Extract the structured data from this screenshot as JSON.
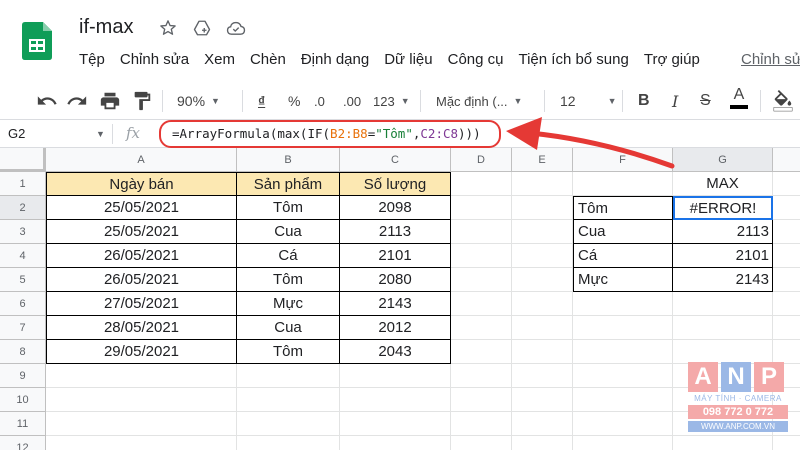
{
  "app": {
    "title": "if-max",
    "menu": [
      "Tệp",
      "Chỉnh sửa",
      "Xem",
      "Chèn",
      "Định dạng",
      "Dữ liệu",
      "Công cụ",
      "Tiện ích bổ sung",
      "Trợ giúp"
    ],
    "menu_last": "Chỉnh sử"
  },
  "toolbar": {
    "zoom": "90%",
    "currency": "₫",
    "percent": "%",
    "dec_decrease": ".0",
    "dec_increase": ".00",
    "format_more": "123",
    "font": "Mặc định (...",
    "font_size": "12",
    "bold": "B",
    "italic": "I",
    "strike": "S",
    "text_color": "A"
  },
  "formula_bar": {
    "name_box": "G2",
    "fx": "fx",
    "formula_parts": [
      "=ArrayFormula(max(IF(",
      "B2:B8",
      "=",
      "\"Tôm\"",
      ",",
      "C2:C8",
      ")))"
    ]
  },
  "grid": {
    "columns": [
      "A",
      "B",
      "C",
      "D",
      "E",
      "F",
      "G"
    ],
    "rows": [
      "1",
      "2",
      "3",
      "4",
      "5",
      "6",
      "7",
      "8",
      "9",
      "10",
      "11",
      "12"
    ],
    "table_headers": [
      "Ngày bán",
      "Sản phẩm",
      "Số lượng"
    ],
    "table_rows": [
      [
        "25/05/2021",
        "Tôm",
        "2098"
      ],
      [
        "25/05/2021",
        "Cua",
        "2113"
      ],
      [
        "26/05/2021",
        "Cá",
        "2101"
      ],
      [
        "26/05/2021",
        "Tôm",
        "2080"
      ],
      [
        "27/05/2021",
        "Mực",
        "2143"
      ],
      [
        "28/05/2021",
        "Cua",
        "2012"
      ],
      [
        "29/05/2021",
        "Tôm",
        "2043"
      ]
    ],
    "max_header": "MAX",
    "max_rows": [
      [
        "Tôm",
        "#ERROR!"
      ],
      [
        "Cua",
        "2113"
      ],
      [
        "Cá",
        "2101"
      ],
      [
        "Mực",
        "2143"
      ]
    ]
  },
  "watermark": {
    "letters": [
      "A",
      "N",
      "P"
    ],
    "subtitle": "MÁY TÍNH · CAMERA",
    "phone": "098 772 0 772",
    "website": "WWW.ANP.COM.VN"
  },
  "colors": {
    "header_fill": "#fce8b2",
    "selection": "#1a73e8",
    "annotation": "#e53935",
    "sheets_green": "#0f9d58"
  }
}
